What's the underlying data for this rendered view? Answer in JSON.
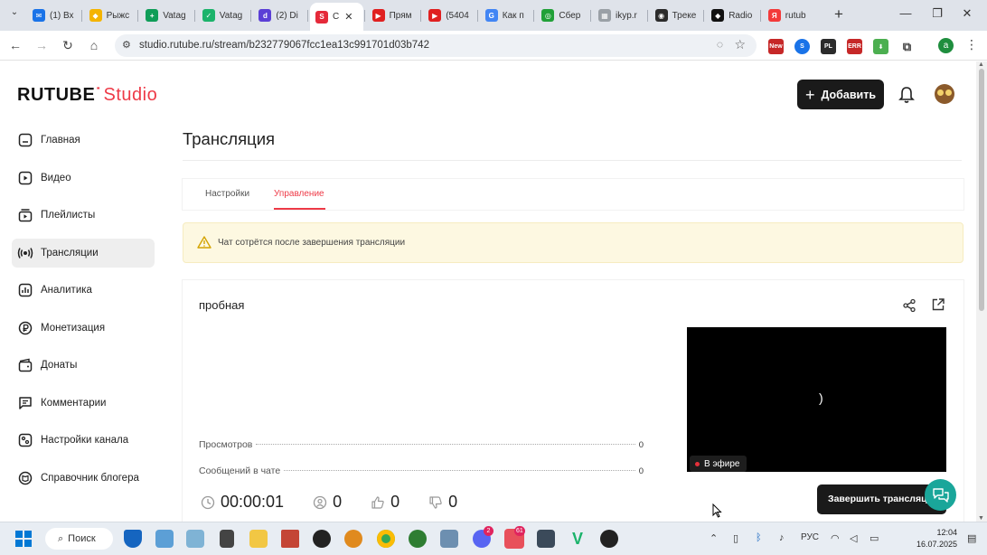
{
  "browser": {
    "tabs": [
      {
        "title": "(1) Вх",
        "favicon_color": "#1a73e8",
        "favicon": "✉"
      },
      {
        "title": "Рыжс",
        "favicon_color": "#f4b400",
        "favicon": "◆"
      },
      {
        "title": "Vatag",
        "favicon_color": "#0f9d58",
        "favicon": "+"
      },
      {
        "title": "Vatag",
        "favicon_color": "#1bb36b",
        "favicon": "✓"
      },
      {
        "title": "(2) Di",
        "favicon_color": "#5b3fd6",
        "favicon": "d"
      },
      {
        "title": "C",
        "favicon_color": "#e52a3a",
        "favicon": "S",
        "active": true
      },
      {
        "title": "Прям",
        "favicon_color": "#e02020",
        "favicon": "▶"
      },
      {
        "title": "(5404",
        "favicon_color": "#e02020",
        "favicon": "▶"
      },
      {
        "title": "Как п",
        "favicon_color": "#4285f4",
        "favicon": "G"
      },
      {
        "title": "Сбер",
        "favicon_color": "#21a038",
        "favicon": "◎"
      },
      {
        "title": "ikyp.r",
        "favicon_color": "#9aa0a6",
        "favicon": "▦"
      },
      {
        "title": "Треке",
        "favicon_color": "#2b2b2b",
        "favicon": "◉"
      },
      {
        "title": "Radio",
        "favicon_color": "#111111",
        "favicon": "◆"
      },
      {
        "title": "rutub",
        "favicon_color": "#f33a3a",
        "favicon": "Я"
      }
    ],
    "url": "studio.rutube.ru/stream/b232779067fcc1ea13c991701d03b742"
  },
  "header": {
    "logo_main": "RUTUBE",
    "logo_suffix": "Studio",
    "add_button": "Добавить"
  },
  "sidebar": {
    "items": [
      {
        "label": "Главная",
        "icon": "home-icon"
      },
      {
        "label": "Видео",
        "icon": "video-icon"
      },
      {
        "label": "Плейлисты",
        "icon": "playlist-icon"
      },
      {
        "label": "Трансляции",
        "icon": "broadcast-icon",
        "active": true
      },
      {
        "label": "Аналитика",
        "icon": "analytics-icon"
      },
      {
        "label": "Монетизация",
        "icon": "ruble-icon"
      },
      {
        "label": "Донаты",
        "icon": "wallet-icon"
      },
      {
        "label": "Комментарии",
        "icon": "comment-icon"
      },
      {
        "label": "Настройки канала",
        "icon": "settings-icon"
      },
      {
        "label": "Справочник блогера",
        "icon": "book-icon"
      }
    ]
  },
  "main": {
    "title": "Трансляция",
    "tabs": [
      {
        "label": "Настройки"
      },
      {
        "label": "Управление",
        "active": true
      }
    ],
    "warning": "Чат сотрётся после завершения трансляции",
    "stream": {
      "name": "пробная",
      "stats": [
        {
          "label": "Просмотров",
          "value": "0"
        },
        {
          "label": "Сообщений в чате",
          "value": "0"
        }
      ],
      "spinner_glyph": ")",
      "live_badge": "В эфире",
      "duration": "00:00:01",
      "viewers": "0",
      "likes": "0",
      "dislikes": "0",
      "end_button": "Завершить трансляцию"
    }
  },
  "taskbar": {
    "search_label": "Поиск",
    "language": "РУС",
    "time": "12:04",
    "date": "16.07.2025",
    "badges": {
      "discord": "2",
      "chat": "61"
    }
  },
  "colors": {
    "brand_red": "#ee3a47",
    "dark_button": "#1a1a1a",
    "warning_bg": "#fdf8e1",
    "chat_fab": "#1aa69a",
    "live_dot": "#e5303a"
  }
}
